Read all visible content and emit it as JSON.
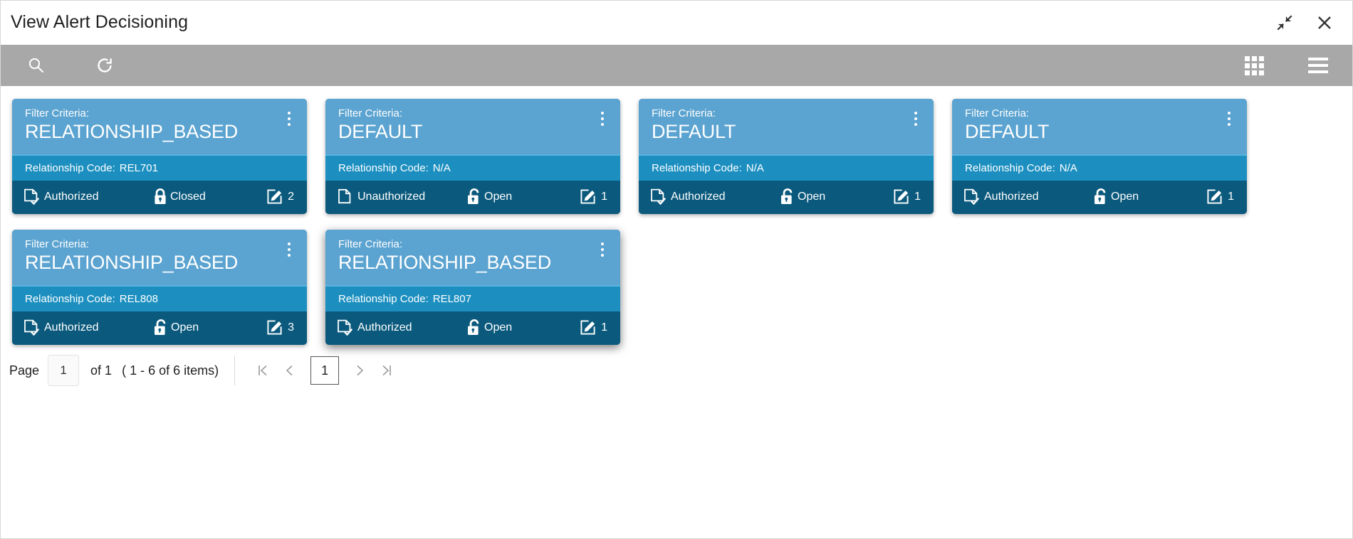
{
  "window": {
    "title": "View Alert Decisioning",
    "minimize_icon": "collapse-arrows-icon",
    "close_icon": "close-icon"
  },
  "toolbar": {
    "search_icon": "search-icon",
    "refresh_icon": "refresh-icon",
    "tile_view_icon": "grid-view-icon",
    "list_view_icon": "list-view-icon"
  },
  "card_labels": {
    "filter_criteria": "Filter Criteria:",
    "relationship_code": "Relationship Code:",
    "kebab_icon": "more-options-icon",
    "auth_icon": "document-check-icon",
    "unauth_icon": "document-icon",
    "lock_closed_icon": "lock-closed-icon",
    "lock_open_icon": "lock-open-icon",
    "edit_icon": "edit-pencil-icon"
  },
  "cards": [
    {
      "filter_criteria": "RELATIONSHIP_BASED",
      "relationship_code": "REL701",
      "auth_status": "Authorized",
      "record_status": "Closed",
      "count": "2",
      "selected": false
    },
    {
      "filter_criteria": "DEFAULT",
      "relationship_code": "N/A",
      "auth_status": "Unauthorized",
      "record_status": "Open",
      "count": "1",
      "selected": false
    },
    {
      "filter_criteria": "DEFAULT",
      "relationship_code": "N/A",
      "auth_status": "Authorized",
      "record_status": "Open",
      "count": "1",
      "selected": false
    },
    {
      "filter_criteria": "DEFAULT",
      "relationship_code": "N/A",
      "auth_status": "Authorized",
      "record_status": "Open",
      "count": "1",
      "selected": false
    },
    {
      "filter_criteria": "RELATIONSHIP_BASED",
      "relationship_code": "REL808",
      "auth_status": "Authorized",
      "record_status": "Open",
      "count": "3",
      "selected": false
    },
    {
      "filter_criteria": "RELATIONSHIP_BASED",
      "relationship_code": "REL807",
      "auth_status": "Authorized",
      "record_status": "Open",
      "count": "1",
      "selected": true
    }
  ],
  "pagination": {
    "page_label": "Page",
    "page_value": "1",
    "of_text": "of 1",
    "items_text": "( 1 - 6 of 6 items)",
    "first_icon": "first-page-icon",
    "prev_icon": "previous-page-icon",
    "current_page": "1",
    "next_icon": "next-page-icon",
    "last_icon": "last-page-icon"
  },
  "colors": {
    "card_header": "#5ba3d0",
    "card_mid": "#1c8fc0",
    "card_footer": "#0b5a7d",
    "toolbar": "#a8a8a8",
    "divider": "#58b4de"
  }
}
